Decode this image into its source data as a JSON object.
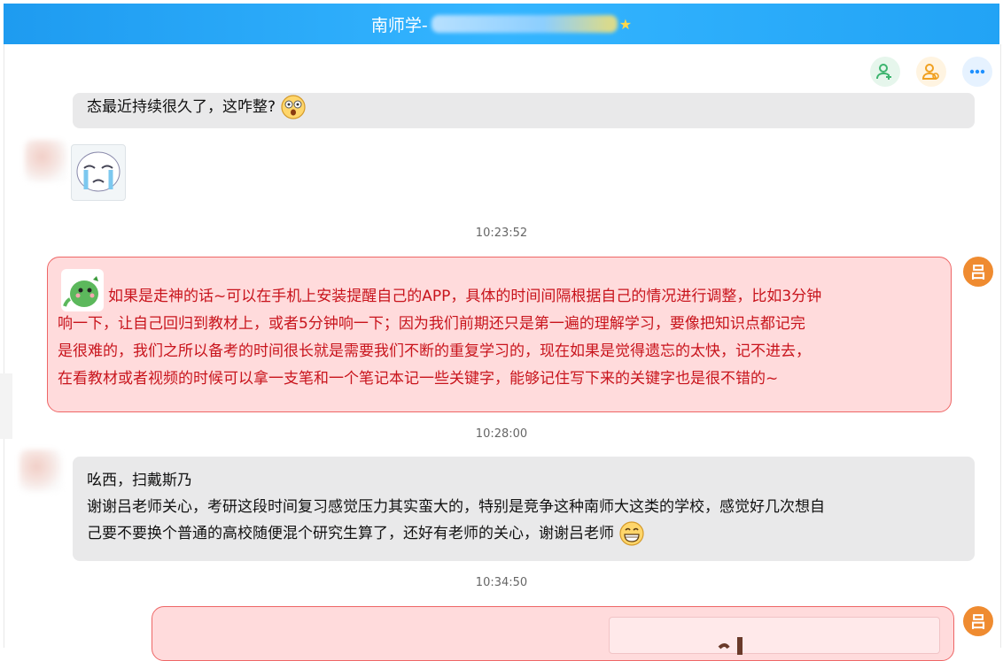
{
  "window": {
    "title": "南师学-",
    "title_icon": "star-icon"
  },
  "toolbar": [
    {
      "name": "add-friend-button",
      "icon": "add-person-icon",
      "color": "#3cb46e"
    },
    {
      "name": "group-button",
      "icon": "group-person-icon",
      "color": "#f0a020"
    },
    {
      "name": "more-button",
      "icon": "more-dots-icon",
      "color": "#1e90ff"
    }
  ],
  "messages": {
    "m1": {
      "text": "态最近持续很久了，这咋整?"
    },
    "t1": "10:23:52",
    "m3": {
      "line1": "如果是走神的话~可以在手机上安装提醒自己的APP，具体的时间间隔根据自己的情况进行调整，比如3分钟",
      "line2": "响一下，让自己回归到教材上，或者5分钟响一下；因为我们前期还只是第一遍的理解学习，要像把知识点都记完",
      "line3": "是很难的，我们之所以备考的时间很长就是需要我们不断的重复学习的，现在如果是觉得遗忘的太快，记不进去，",
      "line4": "在看教材或者视频的时候可以拿一支笔和一个笔记本记一些关键字，能够记住写下来的关键字也是很不错的~"
    },
    "t2": "10:28:00",
    "m4": {
      "line1": "吆西，扫戴斯乃",
      "line2": "谢谢吕老师关心，考研这段时间复习感觉压力其实蛮大的，特别是竞争这种南师大这类的学校，感觉好几次想自",
      "line3": "己要不要换个普通的高校随便混个研究生算了，还好有老师的关心，谢谢吕老师"
    },
    "t3": "10:34:50"
  },
  "teacher_avatar": {
    "char": "吕",
    "color": "#ef8b30"
  },
  "colors": {
    "my_bubble_bg": "#ffdbdc",
    "my_bubble_border": "#e66666",
    "my_text": "#c8141c",
    "other_bubble_bg": "#e9e9ea"
  }
}
